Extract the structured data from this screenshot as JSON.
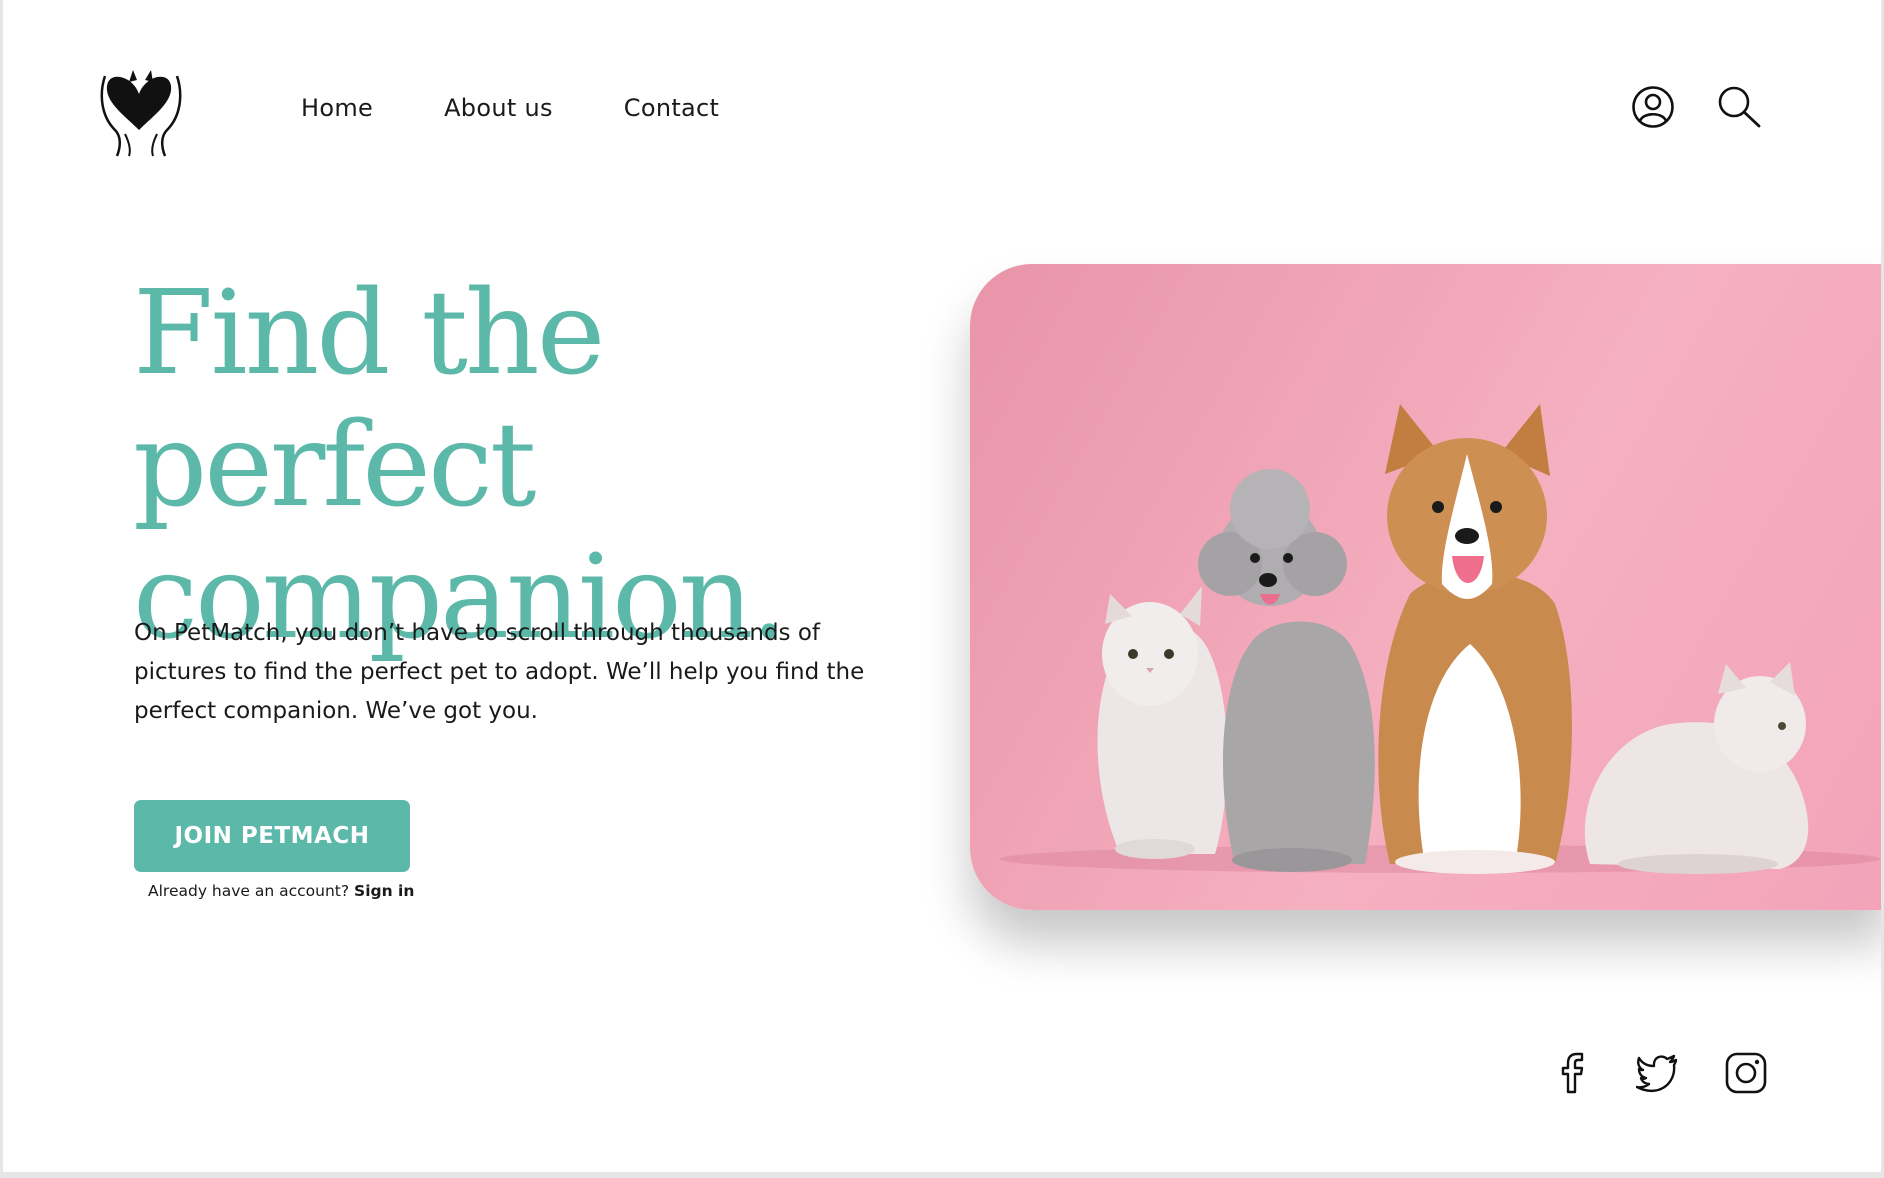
{
  "nav": {
    "home": "Home",
    "about": "About us",
    "contact": "Contact"
  },
  "header": {
    "icons": [
      "user-icon",
      "search-icon"
    ]
  },
  "hero": {
    "title_line1": "Find the perfect",
    "title_line2": "companion.",
    "description": "On PetMatch, you don’t have to scroll through thousands of pictures to find the perfect pet to adopt. We’ll help you find the perfect companion. We’ve got you.",
    "cta_label": "JOIN PETMACH",
    "signin_prompt": "Already have an account?",
    "signin_link": "Sign in",
    "image_alt": "Two cats, a grey poodle and a corgi sitting on a pink background"
  },
  "social": {
    "icons": [
      "facebook-icon",
      "twitter-icon",
      "instagram-icon"
    ]
  },
  "colors": {
    "accent": "#5cb9aa",
    "text": "#1a1a1a",
    "photo_background": "#f3a6ba"
  }
}
